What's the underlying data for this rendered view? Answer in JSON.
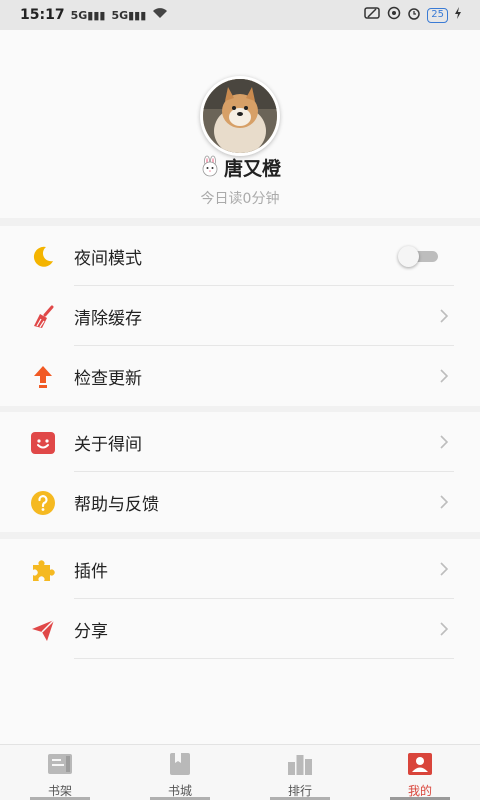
{
  "status_bar": {
    "time": "15:17",
    "signal1": "5G",
    "signal2": "5G",
    "battery": "25"
  },
  "profile": {
    "username": "唐又橙",
    "read_time": "今日读0分钟"
  },
  "menu": {
    "night_mode": {
      "label": "夜间模式",
      "icon": "moon-icon",
      "toggle_on": false
    },
    "clear_cache": {
      "label": "清除缓存",
      "icon": "broom-icon"
    },
    "check_update": {
      "label": "检查更新",
      "icon": "upload-arrow-icon"
    },
    "about": {
      "label": "关于得间",
      "icon": "smile-box-icon"
    },
    "help": {
      "label": "帮助与反馈",
      "icon": "question-icon"
    },
    "plugins": {
      "label": "插件",
      "icon": "puzzle-icon"
    },
    "share": {
      "label": "分享",
      "icon": "paper-plane-icon"
    }
  },
  "tabs": [
    {
      "label": "书架",
      "icon": "bookshelf-icon",
      "active": false
    },
    {
      "label": "书城",
      "icon": "book-icon",
      "active": false
    },
    {
      "label": "排行",
      "icon": "ranking-icon",
      "active": false
    },
    {
      "label": "我的",
      "icon": "profile-icon",
      "active": true
    }
  ],
  "colors": {
    "accent": "#d9453b",
    "moon": "#f4b400",
    "update": "#f15a24",
    "help": "#f5b921",
    "plugin": "#f5b921"
  }
}
